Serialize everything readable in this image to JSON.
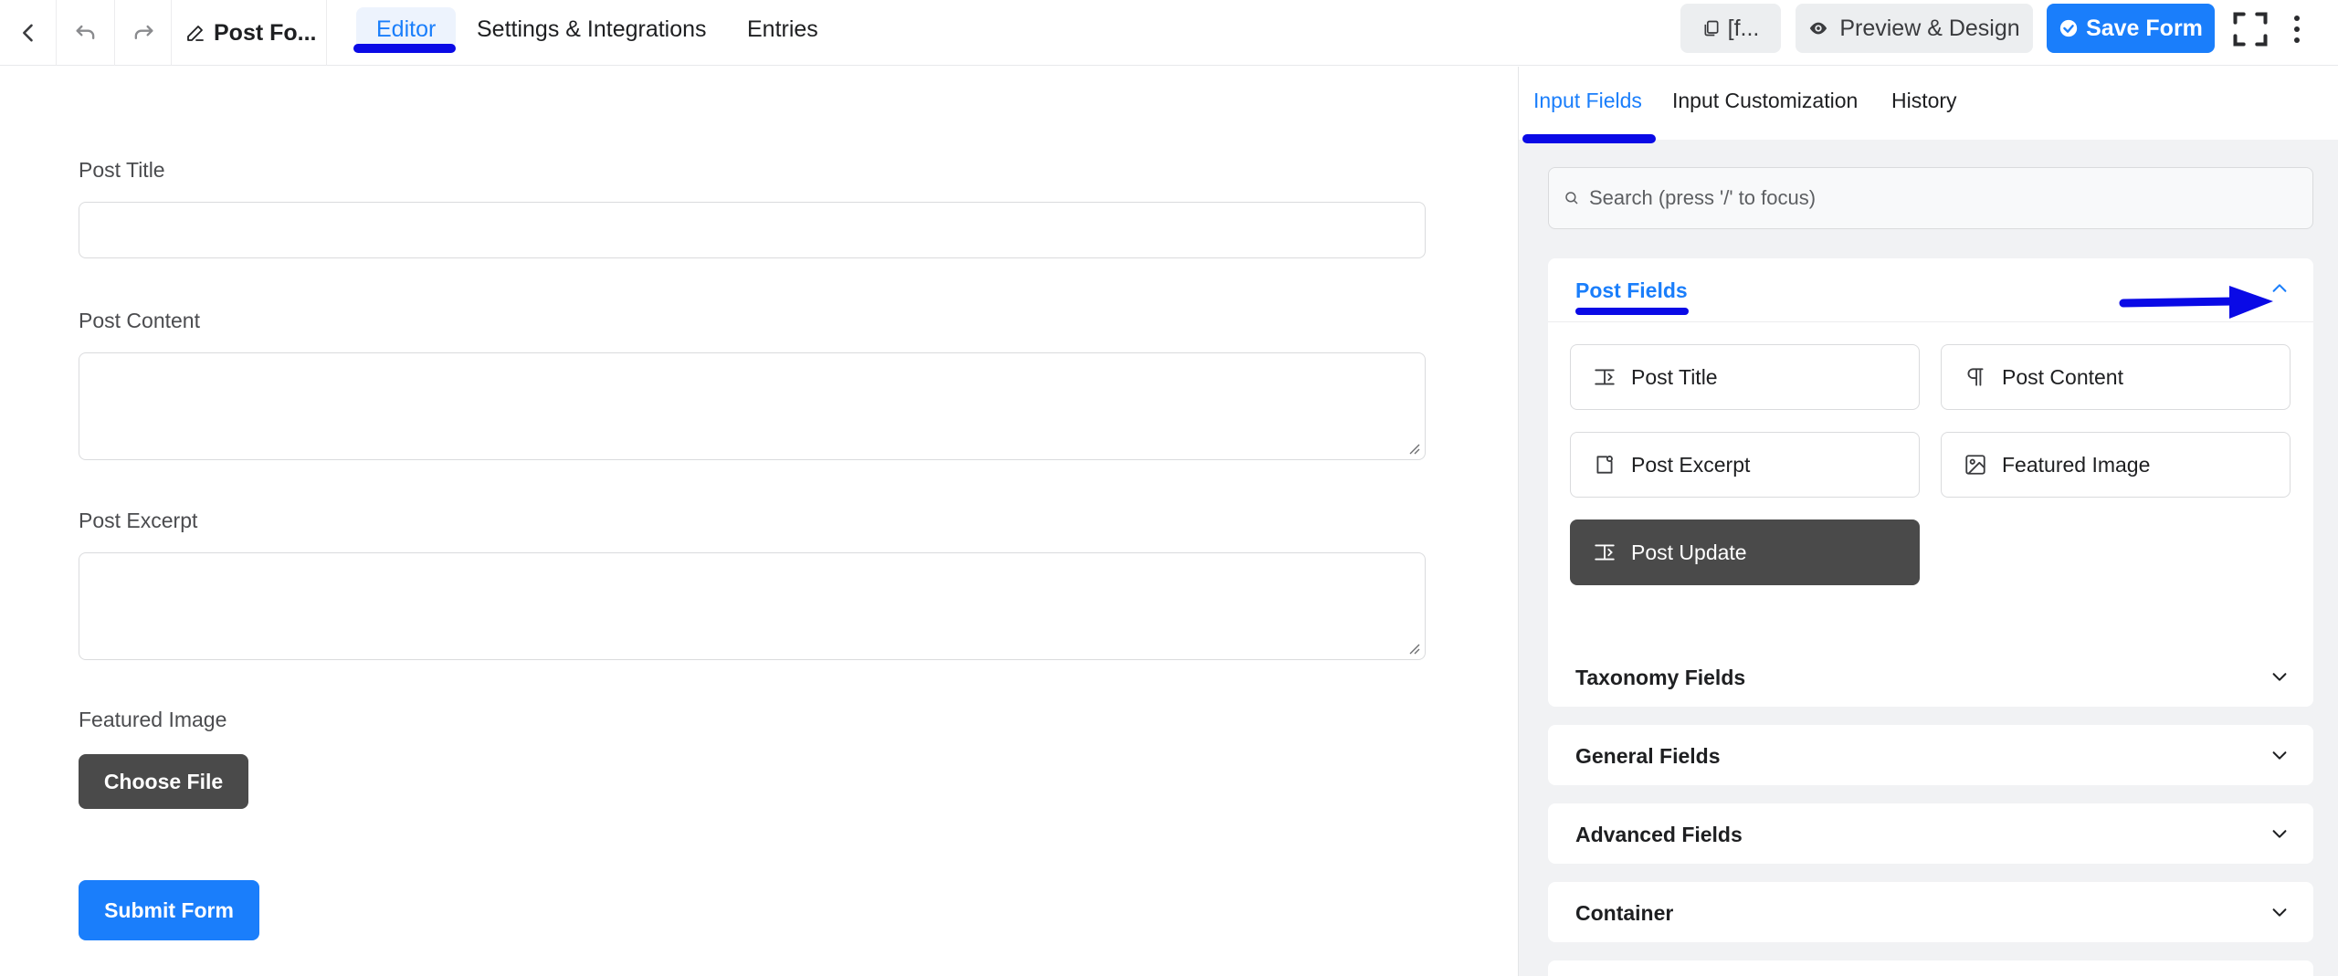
{
  "topbar": {
    "back_icon": "chevron-left-icon",
    "undo_icon": "undo-icon",
    "redo_icon": "redo-icon",
    "form_name": "Post Fo...",
    "tabs": [
      {
        "label": "Editor",
        "active": true
      },
      {
        "label": "Settings & Integrations",
        "active": false
      },
      {
        "label": "Entries",
        "active": false
      }
    ],
    "shortcode_label": "[f...",
    "preview_label": "Preview & Design",
    "save_label": "Save Form",
    "accent_color": "#1a7efb"
  },
  "form": {
    "fields": [
      {
        "label": "Post Title",
        "type": "text"
      },
      {
        "label": "Post Content",
        "type": "textarea"
      },
      {
        "label": "Post Excerpt",
        "type": "textarea"
      },
      {
        "label": "Featured Image",
        "type": "file"
      }
    ],
    "choose_file_label": "Choose File",
    "submit_label": "Submit Form"
  },
  "sidebar": {
    "tabs": [
      {
        "label": "Input Fields",
        "active": true
      },
      {
        "label": "Input Customization",
        "active": false
      },
      {
        "label": "History",
        "active": false
      }
    ],
    "search_placeholder": "Search (press '/' to focus)",
    "post_fields": {
      "title": "Post Fields",
      "expanded": true,
      "items": [
        {
          "label": "Post Title",
          "icon": "text-cursor-icon"
        },
        {
          "label": "Post Content",
          "icon": "paragraph-icon"
        },
        {
          "label": "Post Excerpt",
          "icon": "excerpt-icon"
        },
        {
          "label": "Featured Image",
          "icon": "image-icon"
        },
        {
          "label": "Post Update",
          "icon": "text-cursor-icon",
          "highlighted": true
        }
      ]
    },
    "collapsed_groups": [
      {
        "title": "Taxonomy Fields"
      },
      {
        "title": "General Fields"
      },
      {
        "title": "Advanced Fields"
      },
      {
        "title": "Container"
      }
    ]
  }
}
